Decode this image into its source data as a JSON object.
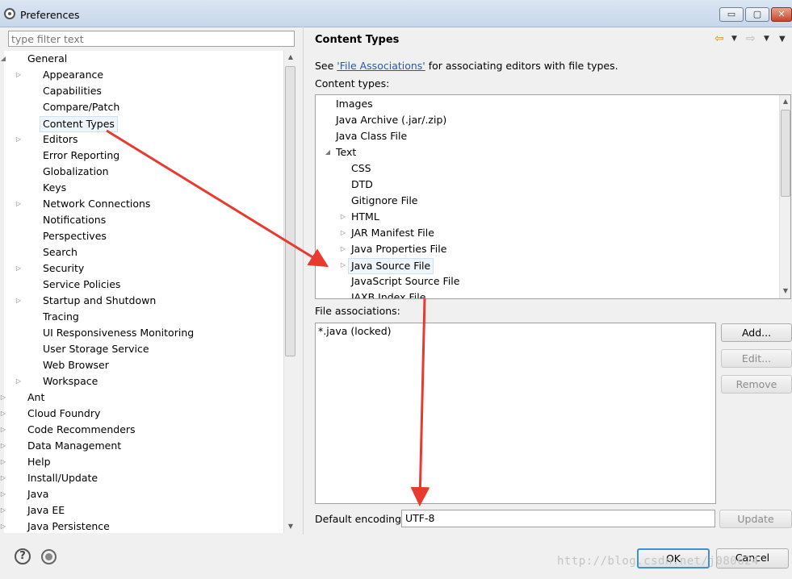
{
  "window": {
    "title": "Preferences",
    "controls": {
      "minimize": "▭",
      "maximize": "▢",
      "close": "✕"
    }
  },
  "filter": {
    "placeholder": "type filter text"
  },
  "left_tree": {
    "items": [
      {
        "label": "General",
        "level": 0,
        "expander": "open"
      },
      {
        "label": "Appearance",
        "level": 1,
        "expander": "closed"
      },
      {
        "label": "Capabilities",
        "level": 1,
        "expander": ""
      },
      {
        "label": "Compare/Patch",
        "level": 1,
        "expander": ""
      },
      {
        "label": "Content Types",
        "level": 1,
        "expander": "",
        "selected": true
      },
      {
        "label": "Editors",
        "level": 1,
        "expander": "closed"
      },
      {
        "label": "Error Reporting",
        "level": 1,
        "expander": ""
      },
      {
        "label": "Globalization",
        "level": 1,
        "expander": ""
      },
      {
        "label": "Keys",
        "level": 1,
        "expander": ""
      },
      {
        "label": "Network Connections",
        "level": 1,
        "expander": "closed"
      },
      {
        "label": "Notifications",
        "level": 1,
        "expander": ""
      },
      {
        "label": "Perspectives",
        "level": 1,
        "expander": ""
      },
      {
        "label": "Search",
        "level": 1,
        "expander": ""
      },
      {
        "label": "Security",
        "level": 1,
        "expander": "closed"
      },
      {
        "label": "Service Policies",
        "level": 1,
        "expander": ""
      },
      {
        "label": "Startup and Shutdown",
        "level": 1,
        "expander": "closed"
      },
      {
        "label": "Tracing",
        "level": 1,
        "expander": ""
      },
      {
        "label": "UI Responsiveness Monitoring",
        "level": 1,
        "expander": ""
      },
      {
        "label": "User Storage Service",
        "level": 1,
        "expander": ""
      },
      {
        "label": "Web Browser",
        "level": 1,
        "expander": ""
      },
      {
        "label": "Workspace",
        "level": 1,
        "expander": "closed"
      },
      {
        "label": "Ant",
        "level": 0,
        "expander": "closed"
      },
      {
        "label": "Cloud Foundry",
        "level": 0,
        "expander": "closed"
      },
      {
        "label": "Code Recommenders",
        "level": 0,
        "expander": "closed"
      },
      {
        "label": "Data Management",
        "level": 0,
        "expander": "closed"
      },
      {
        "label": "Help",
        "level": 0,
        "expander": "closed"
      },
      {
        "label": "Install/Update",
        "level": 0,
        "expander": "closed"
      },
      {
        "label": "Java",
        "level": 0,
        "expander": "closed"
      },
      {
        "label": "Java EE",
        "level": 0,
        "expander": "closed"
      },
      {
        "label": "Java Persistence",
        "level": 0,
        "expander": "closed"
      }
    ]
  },
  "page": {
    "title": "Content Types",
    "see_prefix": "See ",
    "see_link": "'File Associations'",
    "see_suffix": " for associating editors with file types.",
    "content_types_label": "Content types:",
    "content_types": [
      {
        "label": "Images",
        "level": 0,
        "expander": ""
      },
      {
        "label": "Java Archive (.jar/.zip)",
        "level": 0,
        "expander": ""
      },
      {
        "label": "Java Class File",
        "level": 0,
        "expander": ""
      },
      {
        "label": "Text",
        "level": 0,
        "expander": "open"
      },
      {
        "label": "CSS",
        "level": 1,
        "expander": ""
      },
      {
        "label": "DTD",
        "level": 1,
        "expander": ""
      },
      {
        "label": "Gitignore File",
        "level": 1,
        "expander": ""
      },
      {
        "label": "HTML",
        "level": 1,
        "expander": "closed"
      },
      {
        "label": "JAR Manifest File",
        "level": 1,
        "expander": "closed"
      },
      {
        "label": "Java Properties File",
        "level": 1,
        "expander": "closed"
      },
      {
        "label": "Java Source File",
        "level": 1,
        "expander": "closed",
        "selected": true
      },
      {
        "label": "JavaScript Source File",
        "level": 1,
        "expander": ""
      },
      {
        "label": "JAXB Index File",
        "level": 1,
        "expander": ""
      }
    ],
    "file_associations_label": "File associations:",
    "file_associations": [
      "*.java (locked)"
    ],
    "buttons": {
      "add": "Add...",
      "edit": "Edit...",
      "remove": "Remove",
      "update": "Update"
    },
    "encoding_label": "Default encoding:",
    "encoding_value": "UTF-8"
  },
  "footer": {
    "help_glyph": "?",
    "ok": "OK",
    "cancel": "Cancel",
    "watermark": "http://blog.csdn.net/j080624"
  },
  "colors": {
    "annotation_arrow": "#e83a2e",
    "selection_border": "#cde0f5",
    "link": "#2a55b8"
  }
}
